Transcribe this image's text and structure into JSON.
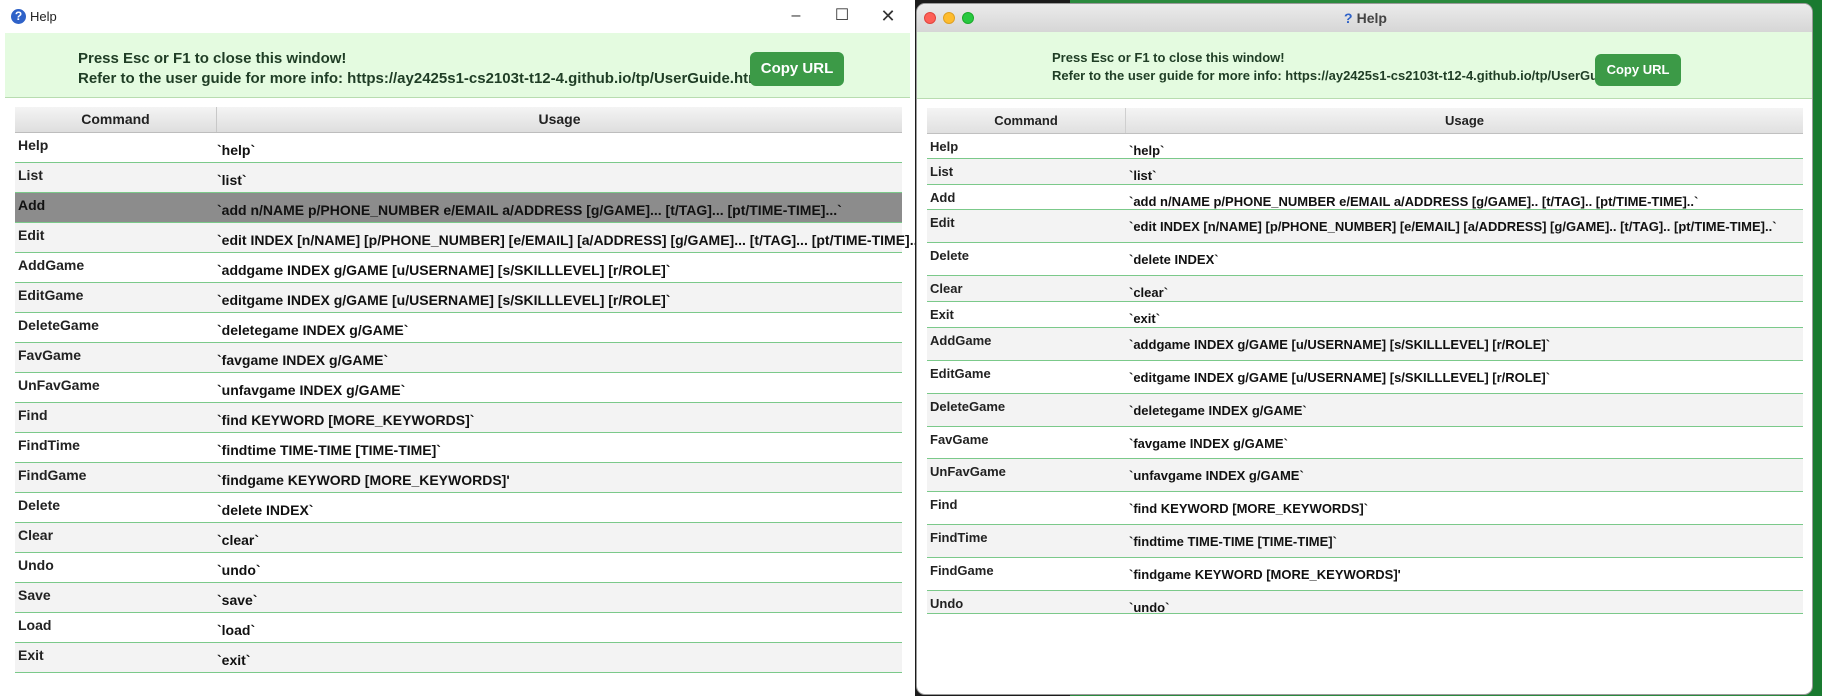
{
  "left_window": {
    "title": "Help",
    "app_icon": "question-icon",
    "controls": {
      "minimize": "–",
      "maximize": "☐",
      "close": "✕"
    },
    "message_line1": "Press Esc or F1 to close this window!",
    "message_line2": "Refer to the user guide for more info: https://ay2425s1-cs2103t-t12-4.github.io/tp/UserGuide.html",
    "copy_button": "Copy URL",
    "headers": {
      "command": "Command",
      "usage": "Usage"
    },
    "rows": [
      {
        "command": "Help",
        "usage": "`help`"
      },
      {
        "command": "List",
        "usage": "`list`"
      },
      {
        "command": "Add",
        "usage": "`add n/NAME p/PHONE_NUMBER e/EMAIL a/ADDRESS [g/GAME]... [t/TAG]... [pt/TIME-TIME]...`"
      },
      {
        "command": "Edit",
        "usage": "`edit INDEX [n/NAME] [p/PHONE_NUMBER] [e/EMAIL] [a/ADDRESS] [g/GAME]... [t/TAG]... [pt/TIME-TIME]...`"
      },
      {
        "command": "AddGame",
        "usage": "`addgame INDEX g/GAME [u/USERNAME] [s/SKILLLEVEL] [r/ROLE]`"
      },
      {
        "command": "EditGame",
        "usage": "`editgame INDEX g/GAME [u/USERNAME] [s/SKILLLEVEL] [r/ROLE]`"
      },
      {
        "command": "DeleteGame",
        "usage": "`deletegame INDEX g/GAME`"
      },
      {
        "command": "FavGame",
        "usage": "`favgame INDEX g/GAME`"
      },
      {
        "command": "UnFavGame",
        "usage": "`unfavgame INDEX g/GAME`"
      },
      {
        "command": "Find",
        "usage": "`find KEYWORD [MORE_KEYWORDS]`"
      },
      {
        "command": "FindTime",
        "usage": "`findtime TIME-TIME [TIME-TIME]`"
      },
      {
        "command": "FindGame",
        "usage": "`findgame KEYWORD [MORE_KEYWORDS]'"
      },
      {
        "command": "Delete",
        "usage": "`delete INDEX`"
      },
      {
        "command": "Clear",
        "usage": "`clear`"
      },
      {
        "command": "Undo",
        "usage": "`undo`"
      },
      {
        "command": "Save",
        "usage": "`save`"
      },
      {
        "command": "Load",
        "usage": "`load`"
      },
      {
        "command": "Exit",
        "usage": "`exit`"
      }
    ],
    "selected_row": "Add"
  },
  "right_window": {
    "title": "Help",
    "title_icon": "question-icon",
    "message_line1": "Press Esc or F1 to close this window!",
    "message_line2": "Refer to the user guide for more info: https://ay2425s1-cs2103t-t12-4.github.io/tp/UserGuide.html",
    "copy_button": "Copy URL",
    "headers": {
      "command": "Command",
      "usage": "Usage"
    },
    "rows": [
      {
        "command": "Help",
        "usage": "`help`"
      },
      {
        "command": "List",
        "usage": "`list`"
      },
      {
        "command": "Add",
        "usage": "`add n/NAME p/PHONE_NUMBER e/EMAIL a/ADDRESS [g/GAME].. [t/TAG].. [pt/TIME-TIME]..`"
      },
      {
        "command": "Edit",
        "usage": "`edit INDEX [n/NAME] [p/PHONE_NUMBER] [e/EMAIL] [a/ADDRESS] [g/GAME].. [t/TAG].. [pt/TIME-TIME]..`"
      },
      {
        "command": "Delete",
        "usage": "`delete INDEX`"
      },
      {
        "command": "Clear",
        "usage": "`clear`"
      },
      {
        "command": "Exit",
        "usage": "`exit`"
      },
      {
        "command": "AddGame",
        "usage": "`addgame INDEX g/GAME [u/USERNAME] [s/SKILLLEVEL] [r/ROLE]`"
      },
      {
        "command": "EditGame",
        "usage": "`editgame INDEX g/GAME [u/USERNAME] [s/SKILLLEVEL] [r/ROLE]`"
      },
      {
        "command": "DeleteGame",
        "usage": "`deletegame INDEX g/GAME`"
      },
      {
        "command": "FavGame",
        "usage": "`favgame INDEX g/GAME`"
      },
      {
        "command": "UnFavGame",
        "usage": "`unfavgame INDEX g/GAME`"
      },
      {
        "command": "Find",
        "usage": "`find KEYWORD [MORE_KEYWORDS]`"
      },
      {
        "command": "FindTime",
        "usage": "`findtime TIME-TIME [TIME-TIME]`"
      },
      {
        "command": "FindGame",
        "usage": "`findgame KEYWORD [MORE_KEYWORDS]'"
      },
      {
        "command": "Undo",
        "usage": "`undo`"
      }
    ]
  },
  "colors": {
    "banner_bg": "#e4fbe0",
    "copy_button_bg": "#3c9a47",
    "row_divider": "#7bc98a",
    "selected_row_bg": "#8c8c8c",
    "traffic_red": "#fe5f57",
    "traffic_yellow": "#febc2e",
    "traffic_green": "#28c840"
  }
}
